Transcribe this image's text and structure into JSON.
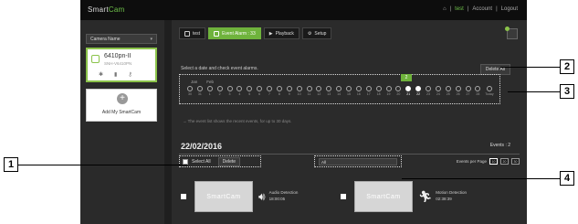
{
  "brand": {
    "prefix": "Smart",
    "suffix": "Cam"
  },
  "topbar": {
    "home_icon": "home-icon",
    "user": "test",
    "account": "Account",
    "logout": "Logout",
    "separator": "|"
  },
  "sidebar": {
    "camera_select": "Camera Name",
    "camera": {
      "name": "6410pn-II",
      "model": "SNH-V6410PN"
    },
    "add_label": "Add My SmartCam"
  },
  "tabs": [
    {
      "label": "test",
      "icon": "camera-icon",
      "active": false
    },
    {
      "label": "Event Alarm : 33",
      "icon": "alarm-icon",
      "active": true
    },
    {
      "label": "Playback",
      "icon": "play-icon",
      "active": false
    },
    {
      "label": "Setup",
      "icon": "gear-icon",
      "active": false
    }
  ],
  "instruction": "Select a date and check event alarms.",
  "delete_all": "Delete All",
  "timeline": {
    "months": [
      "Jan",
      "Feb"
    ],
    "highlight": "2",
    "days": [
      "30",
      "31",
      "1",
      "2",
      "3",
      "4",
      "5",
      "6",
      "7",
      "8",
      "9",
      "10",
      "11",
      "12",
      "13",
      "14",
      "15",
      "16",
      "17",
      "18",
      "19",
      "20",
      "21",
      "22",
      "23",
      "24",
      "25",
      "26",
      "27",
      "28",
      "Today"
    ],
    "selected_days": [
      "21",
      "22"
    ]
  },
  "note": "→ The event list shows the recent events, for up to 30 days.",
  "list": {
    "date": "22/02/2016",
    "events_count": "Events : 2",
    "select_all": "Select All",
    "delete": "Delete",
    "filter": "All",
    "per_page_label": "Events per Page",
    "per_page_options": [
      "10",
      "20",
      "30"
    ]
  },
  "events": [
    {
      "thumb": "SmartCam",
      "type": "Audio Detection",
      "time": "18:00:05",
      "icon": "speaker-icon"
    },
    {
      "thumb": "SmartCam",
      "type": "Motion Detection",
      "time": "02:38:39",
      "icon": "running-person-icon"
    }
  ],
  "callouts": [
    "1",
    "2",
    "3",
    "4"
  ]
}
